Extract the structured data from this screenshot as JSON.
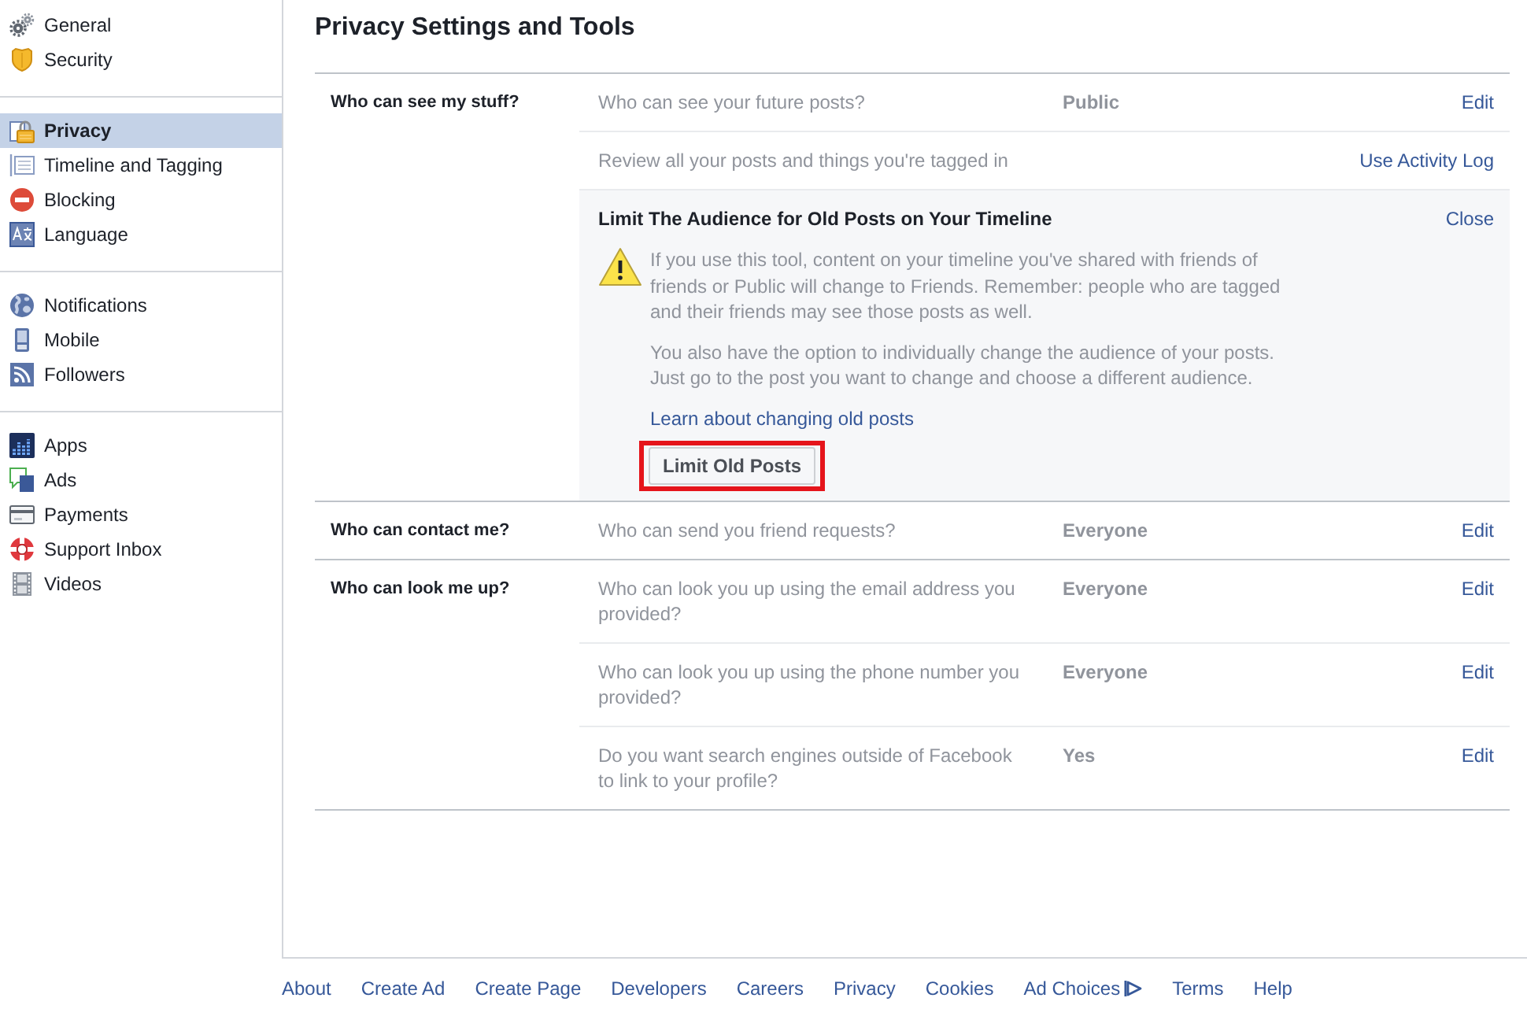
{
  "sidebar": {
    "groups": [
      {
        "items": [
          {
            "label": "General",
            "selected": false
          },
          {
            "label": "Security",
            "selected": false
          }
        ]
      },
      {
        "items": [
          {
            "label": "Privacy",
            "selected": true
          },
          {
            "label": "Timeline and Tagging",
            "selected": false
          },
          {
            "label": "Blocking",
            "selected": false
          },
          {
            "label": "Language",
            "selected": false
          }
        ]
      },
      {
        "items": [
          {
            "label": "Notifications",
            "selected": false
          },
          {
            "label": "Mobile",
            "selected": false
          },
          {
            "label": "Followers",
            "selected": false
          }
        ]
      },
      {
        "items": [
          {
            "label": "Apps",
            "selected": false
          },
          {
            "label": "Ads",
            "selected": false
          },
          {
            "label": "Payments",
            "selected": false
          },
          {
            "label": "Support Inbox",
            "selected": false
          },
          {
            "label": "Videos",
            "selected": false
          }
        ]
      }
    ]
  },
  "main": {
    "title": "Privacy Settings and Tools",
    "sections": [
      {
        "heading": "Who can see my stuff?",
        "rows": [
          {
            "kind": "setting",
            "question": "Who can see your future posts?",
            "value": "Public",
            "action": "Edit"
          },
          {
            "kind": "setting",
            "question": "Review all your posts and things you're tagged in",
            "action": "Use Activity Log"
          },
          {
            "kind": "panel",
            "title": "Limit The Audience for Old Posts on Your Timeline",
            "close": "Close",
            "paragraphs": [
              "If you use this tool, content on your timeline you've shared with friends of friends or Public will change to Friends. Remember: people who are tagged and their friends may see those posts as well.",
              "You also have the option to individually change the audience of your posts. Just go to the post you want to change and choose a different audience."
            ],
            "link": "Learn about changing old posts",
            "button": {
              "label": "Limit Old Posts",
              "highlighted": true
            }
          }
        ]
      },
      {
        "heading": "Who can contact me?",
        "rows": [
          {
            "kind": "setting",
            "question": "Who can send you friend requests?",
            "value": "Everyone",
            "action": "Edit"
          }
        ]
      },
      {
        "heading": "Who can look me up?",
        "rows": [
          {
            "kind": "setting",
            "question": "Who can look you up using the email address you provided?",
            "value": "Everyone",
            "action": "Edit"
          },
          {
            "kind": "setting",
            "question": "Who can look you up using the phone number you provided?",
            "value": "Everyone",
            "action": "Edit"
          },
          {
            "kind": "setting",
            "question": "Do you want search engines outside of Facebook to link to your profile?",
            "value": "Yes",
            "action": "Edit"
          }
        ]
      }
    ]
  },
  "footer": {
    "links": [
      {
        "label": "About",
        "kind": "text"
      },
      {
        "label": "Create Ad",
        "kind": "text"
      },
      {
        "label": "Create Page",
        "kind": "text"
      },
      {
        "label": "Developers",
        "kind": "text"
      },
      {
        "label": "Careers",
        "kind": "text"
      },
      {
        "label": "Privacy",
        "kind": "text"
      },
      {
        "label": "Cookies",
        "kind": "text"
      },
      {
        "label": "Ad Choices",
        "kind": "with-icon"
      },
      {
        "label": "Terms",
        "kind": "text"
      },
      {
        "label": "Help",
        "kind": "text"
      }
    ]
  }
}
